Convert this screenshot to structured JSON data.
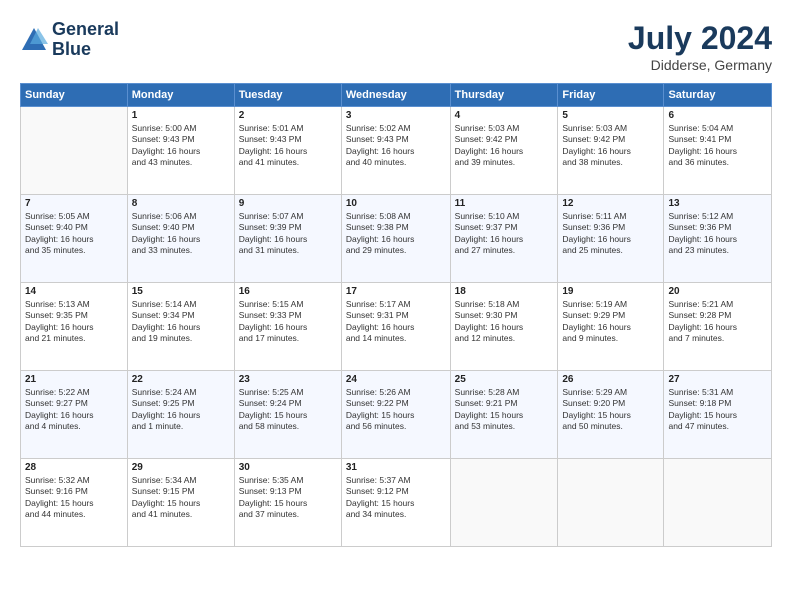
{
  "header": {
    "logo_line1": "General",
    "logo_line2": "Blue",
    "month_year": "July 2024",
    "location": "Didderse, Germany"
  },
  "columns": [
    "Sunday",
    "Monday",
    "Tuesday",
    "Wednesday",
    "Thursday",
    "Friday",
    "Saturday"
  ],
  "weeks": [
    [
      {
        "day": "",
        "info": ""
      },
      {
        "day": "1",
        "info": "Sunrise: 5:00 AM\nSunset: 9:43 PM\nDaylight: 16 hours\nand 43 minutes."
      },
      {
        "day": "2",
        "info": "Sunrise: 5:01 AM\nSunset: 9:43 PM\nDaylight: 16 hours\nand 41 minutes."
      },
      {
        "day": "3",
        "info": "Sunrise: 5:02 AM\nSunset: 9:43 PM\nDaylight: 16 hours\nand 40 minutes."
      },
      {
        "day": "4",
        "info": "Sunrise: 5:03 AM\nSunset: 9:42 PM\nDaylight: 16 hours\nand 39 minutes."
      },
      {
        "day": "5",
        "info": "Sunrise: 5:03 AM\nSunset: 9:42 PM\nDaylight: 16 hours\nand 38 minutes."
      },
      {
        "day": "6",
        "info": "Sunrise: 5:04 AM\nSunset: 9:41 PM\nDaylight: 16 hours\nand 36 minutes."
      }
    ],
    [
      {
        "day": "7",
        "info": "Sunrise: 5:05 AM\nSunset: 9:40 PM\nDaylight: 16 hours\nand 35 minutes."
      },
      {
        "day": "8",
        "info": "Sunrise: 5:06 AM\nSunset: 9:40 PM\nDaylight: 16 hours\nand 33 minutes."
      },
      {
        "day": "9",
        "info": "Sunrise: 5:07 AM\nSunset: 9:39 PM\nDaylight: 16 hours\nand 31 minutes."
      },
      {
        "day": "10",
        "info": "Sunrise: 5:08 AM\nSunset: 9:38 PM\nDaylight: 16 hours\nand 29 minutes."
      },
      {
        "day": "11",
        "info": "Sunrise: 5:10 AM\nSunset: 9:37 PM\nDaylight: 16 hours\nand 27 minutes."
      },
      {
        "day": "12",
        "info": "Sunrise: 5:11 AM\nSunset: 9:36 PM\nDaylight: 16 hours\nand 25 minutes."
      },
      {
        "day": "13",
        "info": "Sunrise: 5:12 AM\nSunset: 9:36 PM\nDaylight: 16 hours\nand 23 minutes."
      }
    ],
    [
      {
        "day": "14",
        "info": "Sunrise: 5:13 AM\nSunset: 9:35 PM\nDaylight: 16 hours\nand 21 minutes."
      },
      {
        "day": "15",
        "info": "Sunrise: 5:14 AM\nSunset: 9:34 PM\nDaylight: 16 hours\nand 19 minutes."
      },
      {
        "day": "16",
        "info": "Sunrise: 5:15 AM\nSunset: 9:33 PM\nDaylight: 16 hours\nand 17 minutes."
      },
      {
        "day": "17",
        "info": "Sunrise: 5:17 AM\nSunset: 9:31 PM\nDaylight: 16 hours\nand 14 minutes."
      },
      {
        "day": "18",
        "info": "Sunrise: 5:18 AM\nSunset: 9:30 PM\nDaylight: 16 hours\nand 12 minutes."
      },
      {
        "day": "19",
        "info": "Sunrise: 5:19 AM\nSunset: 9:29 PM\nDaylight: 16 hours\nand 9 minutes."
      },
      {
        "day": "20",
        "info": "Sunrise: 5:21 AM\nSunset: 9:28 PM\nDaylight: 16 hours\nand 7 minutes."
      }
    ],
    [
      {
        "day": "21",
        "info": "Sunrise: 5:22 AM\nSunset: 9:27 PM\nDaylight: 16 hours\nand 4 minutes."
      },
      {
        "day": "22",
        "info": "Sunrise: 5:24 AM\nSunset: 9:25 PM\nDaylight: 16 hours\nand 1 minute."
      },
      {
        "day": "23",
        "info": "Sunrise: 5:25 AM\nSunset: 9:24 PM\nDaylight: 15 hours\nand 58 minutes."
      },
      {
        "day": "24",
        "info": "Sunrise: 5:26 AM\nSunset: 9:22 PM\nDaylight: 15 hours\nand 56 minutes."
      },
      {
        "day": "25",
        "info": "Sunrise: 5:28 AM\nSunset: 9:21 PM\nDaylight: 15 hours\nand 53 minutes."
      },
      {
        "day": "26",
        "info": "Sunrise: 5:29 AM\nSunset: 9:20 PM\nDaylight: 15 hours\nand 50 minutes."
      },
      {
        "day": "27",
        "info": "Sunrise: 5:31 AM\nSunset: 9:18 PM\nDaylight: 15 hours\nand 47 minutes."
      }
    ],
    [
      {
        "day": "28",
        "info": "Sunrise: 5:32 AM\nSunset: 9:16 PM\nDaylight: 15 hours\nand 44 minutes."
      },
      {
        "day": "29",
        "info": "Sunrise: 5:34 AM\nSunset: 9:15 PM\nDaylight: 15 hours\nand 41 minutes."
      },
      {
        "day": "30",
        "info": "Sunrise: 5:35 AM\nSunset: 9:13 PM\nDaylight: 15 hours\nand 37 minutes."
      },
      {
        "day": "31",
        "info": "Sunrise: 5:37 AM\nSunset: 9:12 PM\nDaylight: 15 hours\nand 34 minutes."
      },
      {
        "day": "",
        "info": ""
      },
      {
        "day": "",
        "info": ""
      },
      {
        "day": "",
        "info": ""
      }
    ]
  ]
}
